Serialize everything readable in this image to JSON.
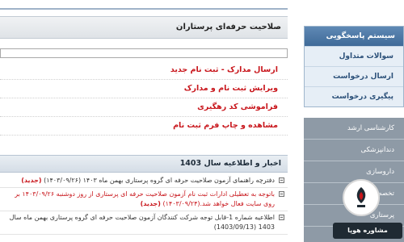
{
  "main": {
    "panel_title": "صلاحیت حرفه‌ای پرستاران",
    "links": [
      "ارسال مدارک - ثبت نام جدید",
      "ویرایش ثبت نام و مدارک",
      "فراموشی کد رهگیری",
      "مشاهده و چاپ فرم ثبت نام"
    ],
    "news_title": "اخبار و اطلاعیه سال 1403",
    "news": [
      {
        "text": "دفترچه راهنمای آزمون صلاحیت حرفه ای گروه پرستاری بهمن ماه ۱۴۰۳ (۱۴۰۳/۰۹/۲۶)",
        "tag": "(جدید)"
      },
      {
        "text": "باتوجه به تعطیلی ادارات ثبت نام آزمون صلاحیت حرفه ای پرستاری از روز دوشنبه ۱۴۰۳/۰۹/۲۶ بر روی سایت فعال خواهد شد.(۱۴۰۳/۰۹/۲۴)",
        "tag": "(جدید)"
      },
      {
        "text": "اطلاعیه شماره 1-قابل توجه شرکت کنندگان آزمون صلاحیت حرفه ای گروه پرستاری بهمن ماه سال 1403 (1403/09/13)",
        "tag": ""
      }
    ]
  },
  "sidebar": {
    "support_title": "سیستم پاسخگویی",
    "support_items": [
      "سوالات متداول",
      "ارسال درخواست",
      "پیگیری درخواست"
    ],
    "nav_items": [
      "کارشناسی ارشد",
      "دندانپزشکی",
      "داروسازی",
      "تخصصی پزشکی",
      "پرستاری"
    ]
  },
  "watermark": {
    "text": "مشاوره هوپا"
  },
  "colors": {
    "accent_red": "#c8151b",
    "sidebar_blue": "#3f6a98",
    "nav_gray": "#8e9aa6"
  }
}
